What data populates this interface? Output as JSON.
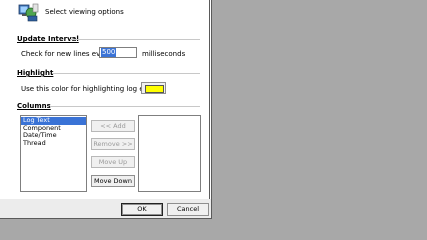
{
  "header": {
    "title": "Select viewing options",
    "icon": "app-settings-icon"
  },
  "update_interval": {
    "section_label": "Update Interval",
    "prefix_label": "Check for new lines every",
    "value": "500",
    "unit_label": "milliseconds"
  },
  "highlight": {
    "section_label": "Highlight",
    "description": "Use this color for highlighting log entries",
    "color": "#ffff00"
  },
  "columns": {
    "section_label": "Columns",
    "available": [
      "Log Text",
      "Component",
      "Date/Time",
      "Thread"
    ],
    "selected_index": 0,
    "buttons": {
      "add": "<< Add",
      "remove": "Remove >>",
      "move_up": "Move Up",
      "move_down": "Move Down"
    }
  },
  "footer": {
    "ok": "OK",
    "cancel": "Cancel"
  },
  "colors": {
    "selection": "#3a73d6",
    "background": "#a8a8a8"
  }
}
